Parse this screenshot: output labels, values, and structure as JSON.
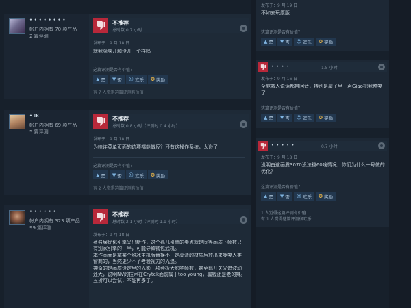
{
  "reviews": [
    {
      "author_name": "• • • • • • • •",
      "products": "帐户内拥有 70 项产品",
      "review_count": "2 篇评测",
      "verdict": "不推荐",
      "hours": "总时数 0.7 小时",
      "posted": "发布于：9 月 18 日",
      "text": [
        "就我隐身开和没开一个样吗"
      ],
      "helpful_question": "这篇评测是否有价值？",
      "buttons": {
        "yes": "是",
        "no": "否",
        "funny": "欢乐",
        "award": "奖励"
      },
      "footnote": "有 7 人觉得这篇评测有价值"
    },
    {
      "author_name": "• lk",
      "products": "帐户内拥有 69 项产品",
      "review_count": "5 篇评测",
      "verdict": "不推荐",
      "hours": "总时数 0.8 小时（评测时 0.4 小时）",
      "posted": "发布于：9 月 18 日",
      "text": [
        "为啥连菜单页面的选项都能做反？还有这操作系统，太逊了"
      ],
      "helpful_question": "这篇评测是否有价值？",
      "buttons": {
        "yes": "是",
        "no": "否",
        "funny": "欢乐",
        "award": "奖励"
      },
      "footnote": "有 2 人觉得这篇评测有价值"
    },
    {
      "author_name": "• • • • • •",
      "products": "帐户内拥有 323 项产品",
      "review_count": "99 篇评测",
      "verdict": "不推荐",
      "hours": "总时数 2.1 小时（评测时 1.1 小时）",
      "posted": "发布于：9 月 18 日",
      "text": [
        "著名屎优化引擎又出新作，这个孤儿引擎的卖点就是同等画质下帧数只有别家引擎的一半，可能导致钱包危机。",
        "本作画面是拿某个维冰主机版替换不一定高清的材质后放出来嘲笑人类智商的，当然更少不了考验视力的光追。",
        "神奇的是画质设定里的光影一项会极大影响帧数，甚至比开关光追波动还大，说明NV的技术在Crytek面前属于too young，骗钱还是老的辣。",
        "五折可以尝试，不能再多了。"
      ]
    }
  ],
  "side_reviews": [
    {
      "posted": "发布于：9 月 19 日",
      "text": [
        "不如去玩原版"
      ],
      "helpful_question": "这篇评测是否有价值？",
      "buttons": {
        "yes": "是",
        "no": "否",
        "funny": "欢乐",
        "award": "奖励"
      }
    },
    {
      "author_name": "• • • •",
      "hours": "1.5 小时",
      "posted": "发布于：9 月 16 日",
      "text": [
        "全宛救人说话都带回音，特别是屋子里一声Giao把我整笑了"
      ],
      "helpful_question": "这篇评测是否有价值？",
      "buttons": {
        "yes": "是",
        "no": "否",
        "funny": "欢乐",
        "award": "奖励"
      }
    },
    {
      "author_name": "• • • • •",
      "hours": "0.7 小时",
      "posted": "发布于：9 月 18 日",
      "text": [
        "没明白这画质3070没法稳60啥情况，你们为什么一号做的优化？"
      ],
      "helpful_question": "这篇评测是否有价值？",
      "buttons": {
        "yes": "是",
        "no": "否",
        "funny": "欢乐",
        "award": "奖励"
      },
      "footnote_1": "1 人觉得这篇评测有价值",
      "footnote_2": "有 1 人觉得这篇评测很欢乐"
    }
  ],
  "colors": {
    "thumb_down": "#b8283a",
    "background": "#17202b",
    "card": "#1e2a37",
    "button": "#22374e"
  }
}
